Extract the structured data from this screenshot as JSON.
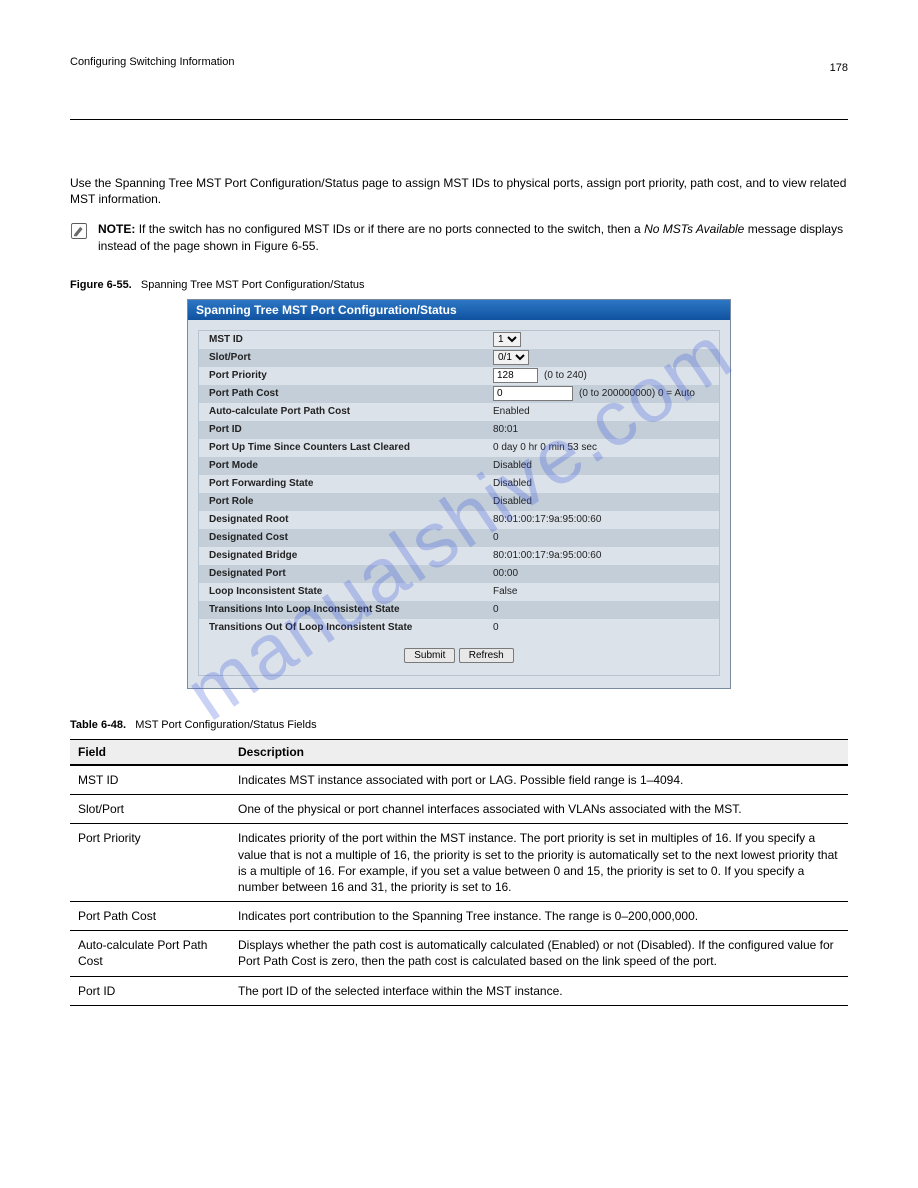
{
  "header": {
    "pagenum": "178",
    "section": "Configuring Switching Information"
  },
  "intro": "Use the Spanning Tree MST Port Configuration/Status page to assign MST IDs to physical ports, assign port priority, path cost, and to view related MST information.",
  "note": {
    "label": "NOTE:",
    "text_before": "If the switch has no configured MST IDs or if there are no ports connected to the switch, then a ",
    "text_italic": "No MSTs Available",
    "text_after": " message displays instead of the page shown in Figure 6-55."
  },
  "figure": {
    "no": "Figure 6-55.",
    "title": "Spanning Tree MST Port Configuration/Status"
  },
  "panel": {
    "title": "Spanning Tree MST Port Configuration/Status",
    "rows": [
      {
        "label": "MST ID",
        "type": "select",
        "value": "1"
      },
      {
        "label": "Slot/Port",
        "type": "select",
        "value": "0/1"
      },
      {
        "label": "Port Priority",
        "type": "input",
        "value": "128",
        "hint": "(0 to 240)",
        "width": 45
      },
      {
        "label": "Port Path Cost",
        "type": "input",
        "value": "0",
        "hint": "(0 to 200000000) 0 = Auto",
        "width": 80
      },
      {
        "label": "Auto-calculate Port Path Cost",
        "type": "text",
        "value": "Enabled"
      },
      {
        "label": "Port ID",
        "type": "text",
        "value": "80:01"
      },
      {
        "label": "Port Up Time Since Counters Last Cleared",
        "type": "text",
        "value": "0 day 0 hr 0 min 53 sec"
      },
      {
        "label": "Port Mode",
        "type": "text",
        "value": "Disabled"
      },
      {
        "label": "Port Forwarding State",
        "type": "text",
        "value": "Disabled"
      },
      {
        "label": "Port Role",
        "type": "text",
        "value": "Disabled"
      },
      {
        "label": "Designated Root",
        "type": "text",
        "value": "80:01:00:17:9a:95:00:60"
      },
      {
        "label": "Designated Cost",
        "type": "text",
        "value": "0"
      },
      {
        "label": "Designated Bridge",
        "type": "text",
        "value": "80:01:00:17:9a:95:00:60"
      },
      {
        "label": "Designated Port",
        "type": "text",
        "value": "00:00"
      },
      {
        "label": "Loop Inconsistent State",
        "type": "text",
        "value": "False"
      },
      {
        "label": "Transitions Into Loop Inconsistent State",
        "type": "text",
        "value": "0"
      },
      {
        "label": "Transitions Out Of Loop Inconsistent State",
        "type": "text",
        "value": "0"
      }
    ],
    "buttons": {
      "submit": "Submit",
      "refresh": "Refresh"
    }
  },
  "table": {
    "no": "Table 6-48.",
    "title": "MST Port Configuration/Status Fields",
    "head_field": "Field",
    "head_desc": "Description",
    "rows": [
      {
        "f": "MST ID",
        "d": "Indicates MST instance associated with port or LAG. Possible field range is 1–4094."
      },
      {
        "f": "Slot/Port",
        "d": "One of the physical or port channel interfaces associated with VLANs associated with the MST."
      },
      {
        "f": "Port Priority",
        "d": "Indicates priority of the port within the MST instance. The port priority is set in multiples of 16. If you specify a value that is not a multiple of 16, the priority is set to the priority is automatically set to the next lowest priority that is a multiple of 16. For example, if you set a value between 0 and 15, the priority is set to 0. If you specify a number between 16 and 31, the priority is set to 16."
      },
      {
        "f": "Port Path Cost",
        "d": "Indicates port contribution to the Spanning Tree instance. The range is 0–200,000,000."
      },
      {
        "f": "Auto-calculate Port Path Cost",
        "d": "Displays whether the path cost is automatically calculated (Enabled) or not (Disabled). If the configured value for Port Path Cost is zero, then the path cost is calculated based on the link speed of the port."
      },
      {
        "f": "Port ID",
        "d": "The port ID of the selected interface within the MST instance."
      }
    ]
  },
  "watermark": "manualshive.com"
}
